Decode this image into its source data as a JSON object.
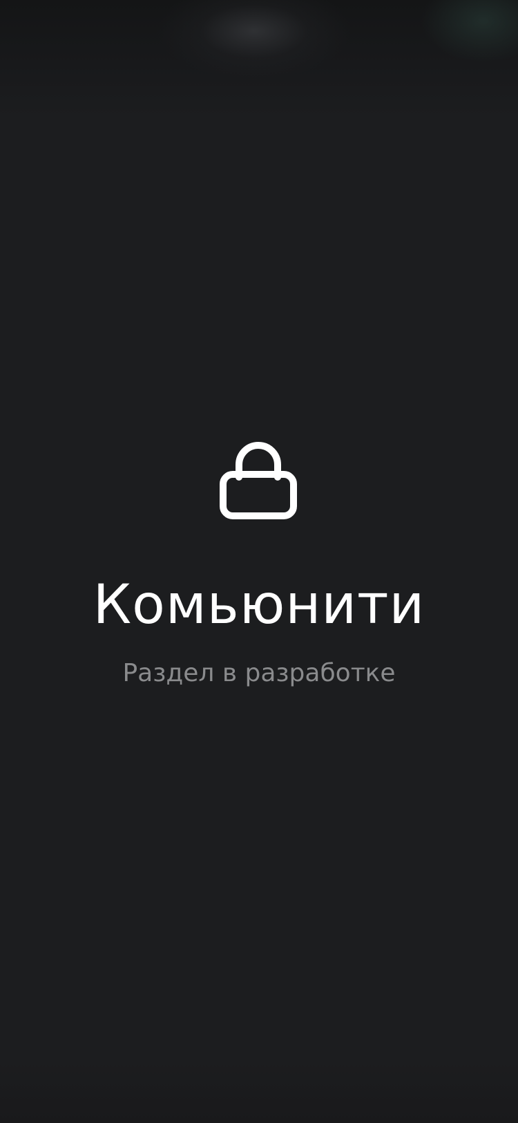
{
  "screen": {
    "background": "#1c1d1f"
  },
  "placeholder": {
    "icon": "lock-icon",
    "title": "Комьюнити",
    "subtitle": "Раздел в разработке"
  },
  "colors": {
    "title": "#ffffff",
    "subtitle": "#8a8b8d",
    "icon": "#ffffff"
  }
}
